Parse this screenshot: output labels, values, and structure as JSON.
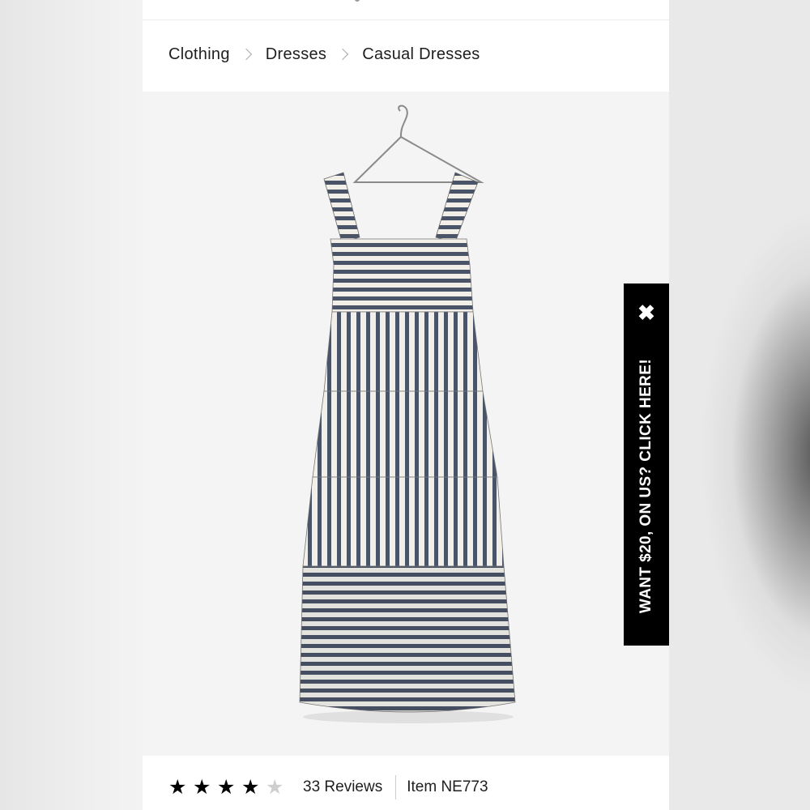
{
  "breadcrumb": {
    "items": [
      {
        "label": "Clothing"
      },
      {
        "label": "Dresses"
      },
      {
        "label": "Casual Dresses"
      }
    ]
  },
  "product": {
    "image_alt": "Striped tiered midi dress on hanger",
    "rating": 4.5,
    "rating_max": 5,
    "reviews_label": "33 Reviews",
    "item_label": "Item NE773"
  },
  "promo": {
    "text": "WANT $20, ON US? CLICK HERE!",
    "close_icon": "close-icon",
    "background": "#000000",
    "color": "#ffffff"
  },
  "icons": {
    "star": "★",
    "close": "✖"
  }
}
